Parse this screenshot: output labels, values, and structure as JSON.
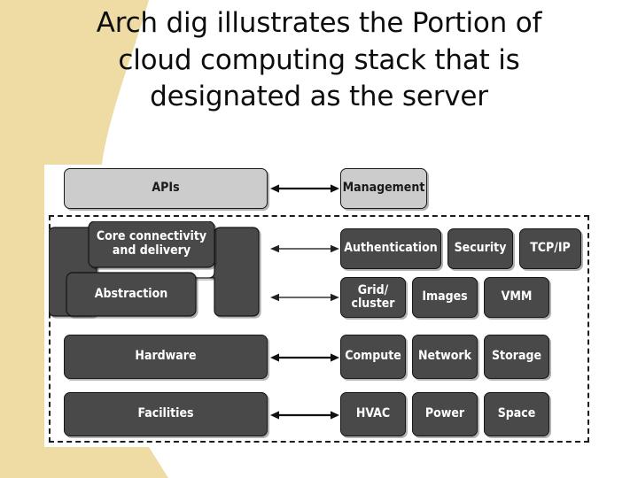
{
  "slide": {
    "title": "Arch dig illustrates the Portion of cloud computing stack that is designated as the server",
    "title_lines": [
      "Arch dig illustrates the Portion of",
      "cloud computing stack that is",
      "designated as the server"
    ]
  },
  "colors": {
    "accent_beige": "#eedca4",
    "box_light": "#cccccc",
    "box_dark": "#494949",
    "outline": "#1a1a1a",
    "panel_background": "#ffffff",
    "text_dark": "#1a1a1a",
    "text_light": "#ffffff"
  },
  "diagram": {
    "scope_note": "dashed boundary marks the server portion of the stack",
    "left_column": [
      {
        "label": "APIs",
        "style": "light"
      },
      {
        "label": "Core connectivity and delivery",
        "style": "dark"
      },
      {
        "label": "Abstraction",
        "style": "dark"
      },
      {
        "label": "Hardware",
        "style": "dark"
      },
      {
        "label": "Facilities",
        "style": "dark"
      }
    ],
    "rows": [
      {
        "row_name": "apis-row",
        "left_label": "APIs",
        "in_server_scope": false,
        "right_items": [
          {
            "label": "Management",
            "style": "light"
          }
        ]
      },
      {
        "row_name": "core-connectivity-row",
        "left_label": "Core connectivity and delivery",
        "in_server_scope": true,
        "right_items": [
          {
            "label": "Authentication",
            "style": "dark"
          },
          {
            "label": "Security",
            "style": "dark"
          },
          {
            "label": "TCP/IP",
            "style": "dark"
          }
        ]
      },
      {
        "row_name": "abstraction-row",
        "left_label": "Abstraction",
        "in_server_scope": true,
        "right_items": [
          {
            "label": "Grid/ cluster",
            "style": "dark"
          },
          {
            "label": "Images",
            "style": "dark"
          },
          {
            "label": "VMM",
            "style": "dark"
          }
        ]
      },
      {
        "row_name": "hardware-row",
        "left_label": "Hardware",
        "in_server_scope": true,
        "right_items": [
          {
            "label": "Compute",
            "style": "dark"
          },
          {
            "label": "Network",
            "style": "dark"
          },
          {
            "label": "Storage",
            "style": "dark"
          }
        ]
      },
      {
        "row_name": "facilities-row",
        "left_label": "Facilities",
        "in_server_scope": true,
        "right_items": [
          {
            "label": "HVAC",
            "style": "dark"
          },
          {
            "label": "Power",
            "style": "dark"
          },
          {
            "label": "Space",
            "style": "dark"
          }
        ]
      }
    ],
    "interlock": {
      "upper_label_line1": "Core connectivity",
      "upper_label_line2": "and delivery",
      "lower_label": "Abstraction"
    },
    "grid_cluster": {
      "line1": "Grid/",
      "line2": "cluster"
    },
    "connectors": [
      {
        "name": "apis-management-arrow",
        "kind": "double-arrow"
      },
      {
        "name": "core-authentication-arrow",
        "kind": "double-arrow"
      },
      {
        "name": "abstraction-grid-arrow",
        "kind": "double-arrow"
      },
      {
        "name": "hardware-compute-arrow",
        "kind": "double-arrow"
      },
      {
        "name": "facilities-hvac-arrow",
        "kind": "double-arrow"
      }
    ]
  }
}
